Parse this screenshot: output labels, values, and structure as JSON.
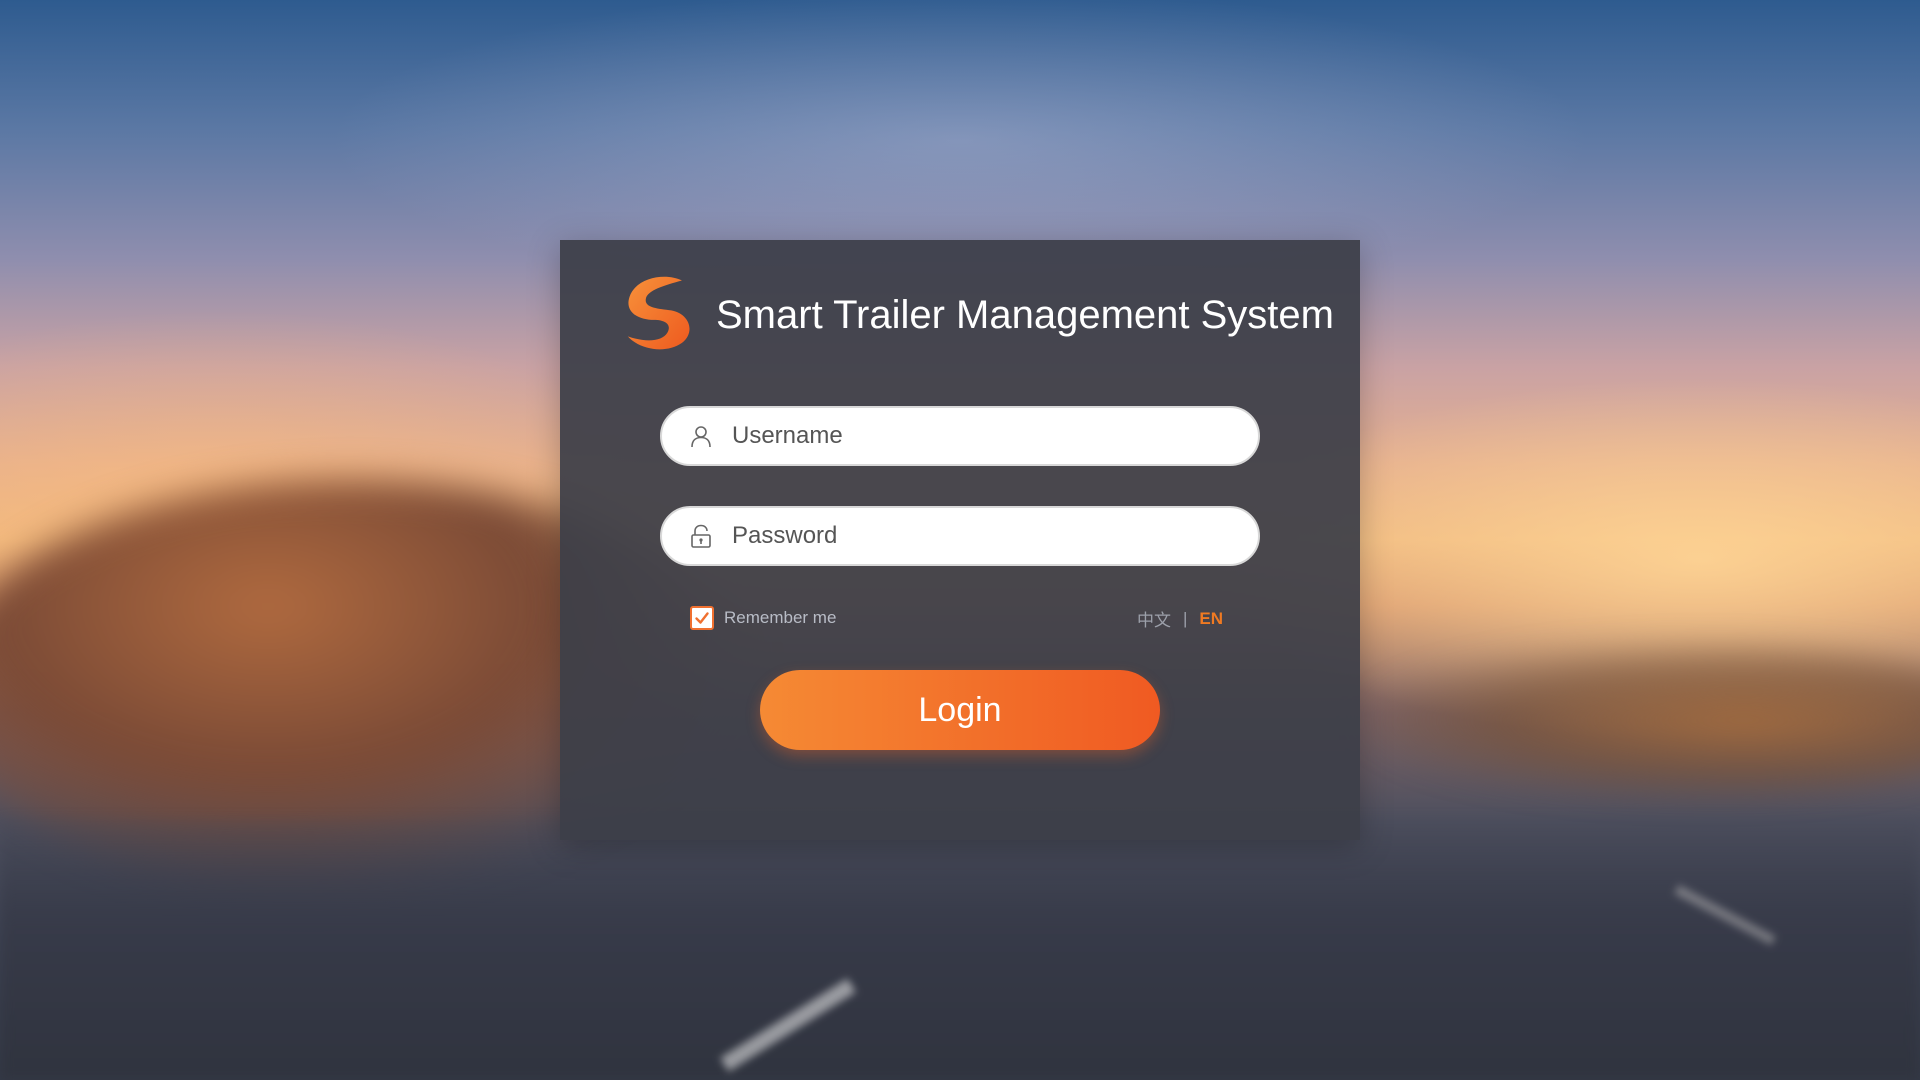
{
  "app": {
    "title": "Smart Trailer Management System",
    "logo_icon": "s-swirl-logo-icon"
  },
  "form": {
    "username": {
      "placeholder": "Username",
      "value": "",
      "icon": "user-icon"
    },
    "password": {
      "placeholder": "Password",
      "value": "",
      "icon": "lock-icon"
    },
    "remember_me": {
      "label": "Remember me",
      "checked": true
    },
    "language": {
      "zh_label": "中文",
      "separator": "|",
      "en_label": "EN",
      "selected": "EN"
    },
    "login_label": "Login"
  },
  "colors": {
    "accent": "#f07a22",
    "accent_gradient_start": "#f58a34",
    "accent_gradient_end": "#f05a22",
    "card_bg": "#3c3e48"
  }
}
